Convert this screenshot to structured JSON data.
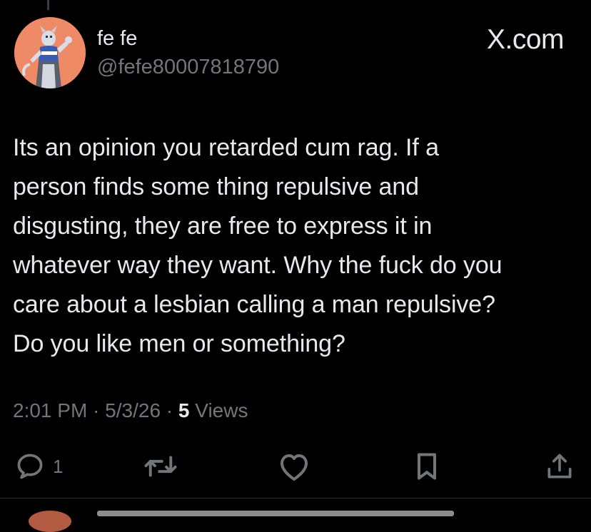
{
  "author": {
    "display_name": "fe fe",
    "handle": "@fefe80007818790",
    "avatar_bg": "#ef8a66"
  },
  "source": {
    "x_mark": "X",
    "label": ".com"
  },
  "tweet": {
    "text": "Its an opinion you retarded cum rag. If a\nperson finds some thing repulsive and\ndisgusting, they are free to express it in\nwhatever way they want. Why the fuck do you\ncare about a lesbian calling a man repulsive?\nDo you like men or something?"
  },
  "meta": {
    "time": "2:01 PM",
    "separator_1": " · ",
    "date": "5/3/26",
    "separator_2": " · ",
    "views_count": "5",
    "views_label": " Views"
  },
  "actions": {
    "reply_count": "1",
    "reply_icon": "reply-icon",
    "retweet_icon": "retweet-icon",
    "like_icon": "heart-icon",
    "bookmark_icon": "bookmark-icon",
    "share_icon": "share-icon"
  },
  "colors": {
    "background": "#000000",
    "primary_text": "#e7e9ea",
    "secondary_text": "#71767b",
    "divider": "#2f3336"
  }
}
